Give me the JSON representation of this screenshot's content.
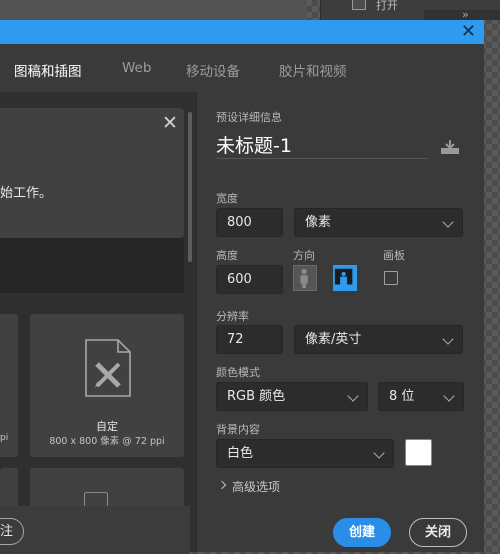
{
  "background_app": {
    "history_label": "打开",
    "collapse_glyph": "»"
  },
  "titlebar": {
    "accent_color": "#2d9cf0",
    "close_glyph": "✕"
  },
  "tabs": [
    {
      "label": "图稿和插图",
      "active": true
    },
    {
      "label": "Web",
      "active": false
    },
    {
      "label": "移动设备",
      "active": false
    },
    {
      "label": "胶片和视频",
      "active": false
    }
  ],
  "welcome": {
    "text": "始工作。",
    "close_glyph": "✕"
  },
  "presets": {
    "partial_tile_spec": "pi",
    "custom_tile": {
      "name": "自定",
      "spec": "800 x 800 像素 @ 72 ppi",
      "icon": "document-ruler-pencil-icon"
    },
    "bottom_button_label": "注"
  },
  "details": {
    "section_label": "预设详细信息",
    "document_name": "未标题-1",
    "save_preset_icon": "save-preset-icon",
    "width": {
      "label": "宽度",
      "value": "800",
      "unit": "像素"
    },
    "height": {
      "label": "高度",
      "value": "600"
    },
    "orientation": {
      "label": "方向",
      "selected": "landscape"
    },
    "artboard": {
      "label": "画板",
      "checked": false
    },
    "resolution": {
      "label": "分辨率",
      "value": "72",
      "unit": "像素/英寸"
    },
    "color_mode": {
      "label": "颜色模式",
      "mode": "RGB 颜色",
      "depth": "8 位"
    },
    "background": {
      "label": "背景内容",
      "value": "白色",
      "swatch_color": "#ffffff"
    },
    "advanced_label": "高级选项"
  },
  "buttons": {
    "create": "创建",
    "close": "关闭",
    "create_color": "#2a8ee8"
  }
}
